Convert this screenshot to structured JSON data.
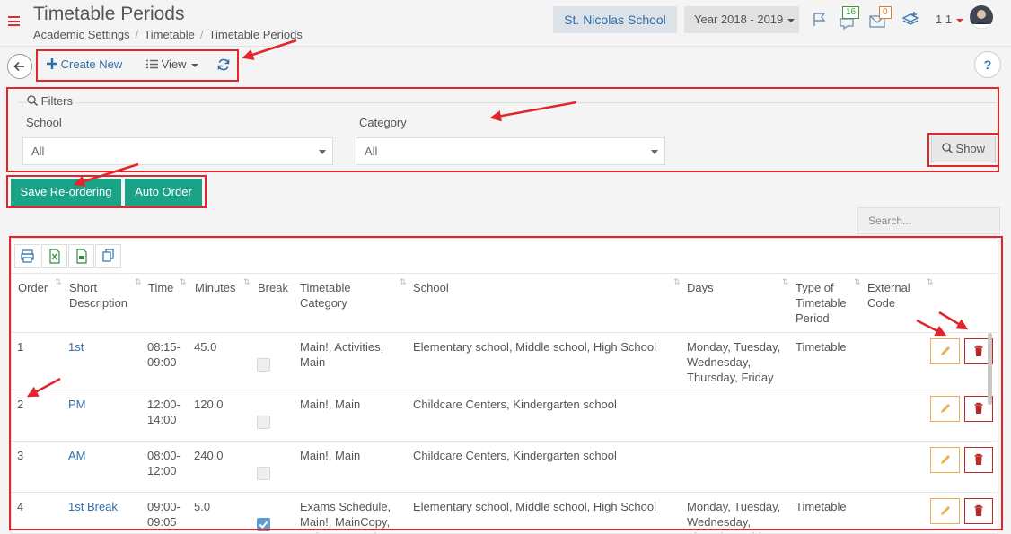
{
  "header": {
    "title": "Timetable Periods",
    "breadcrumb": [
      "Academic Settings",
      "Timetable",
      "Timetable Periods"
    ],
    "school": "St. Nicolas School",
    "year": "Year 2018 - 2019",
    "notifications_count": "16",
    "messages_count": "0",
    "user_number": "1 1"
  },
  "toolbar": {
    "create_new": "Create New",
    "view": "View"
  },
  "filters": {
    "legend": "Filters",
    "school_label": "School",
    "school_value": "All",
    "category_label": "Category",
    "category_value": "All",
    "show_label": "Show"
  },
  "actions": {
    "save_reordering": "Save Re-ordering",
    "auto_order": "Auto Order"
  },
  "search": {
    "placeholder": "Search..."
  },
  "table": {
    "columns": [
      "Order",
      "Short Description",
      "Time",
      "Minutes",
      "Break",
      "Timetable Category",
      "School",
      "Days",
      "Type of Timetable Period",
      "External Code"
    ],
    "rows": [
      {
        "order": "1",
        "short": "1st",
        "time": "08:15-09:00",
        "minutes": "45.0",
        "break": false,
        "category": "Main!, Activities, Main",
        "school": "Elementary school, Middle school, High School",
        "days": "Monday, Tuesday, Wednesday, Thursday, Friday",
        "type": "Timetable",
        "ext": ""
      },
      {
        "order": "2",
        "short": "PM",
        "time": "12:00-14:00",
        "minutes": "120.0",
        "break": false,
        "category": "Main!, Main",
        "school": "Childcare Centers, Kindergarten school",
        "days": "",
        "type": "",
        "ext": ""
      },
      {
        "order": "3",
        "short": "AM",
        "time": "08:00-12:00",
        "minutes": "240.0",
        "break": false,
        "category": "Main!, Main",
        "school": "Childcare Centers, Kindergarten school",
        "days": "",
        "type": "",
        "ext": ""
      },
      {
        "order": "4",
        "short": "1st Break",
        "time": "09:00-09:05",
        "minutes": "5.0",
        "break": true,
        "category": "Exams Schedule, Main!, MainCopy, MainCopy, Main",
        "school": "Elementary school, Middle school, High School",
        "days": "Monday, Tuesday, Wednesday, Thursday, Friday",
        "type": "Timetable",
        "ext": ""
      }
    ]
  },
  "colors": {
    "accent": "#2f6ea8",
    "green": "#1aa387",
    "annotation": "#e0262a",
    "edit": "#f0ad4e",
    "delete": "#b52b2b"
  }
}
